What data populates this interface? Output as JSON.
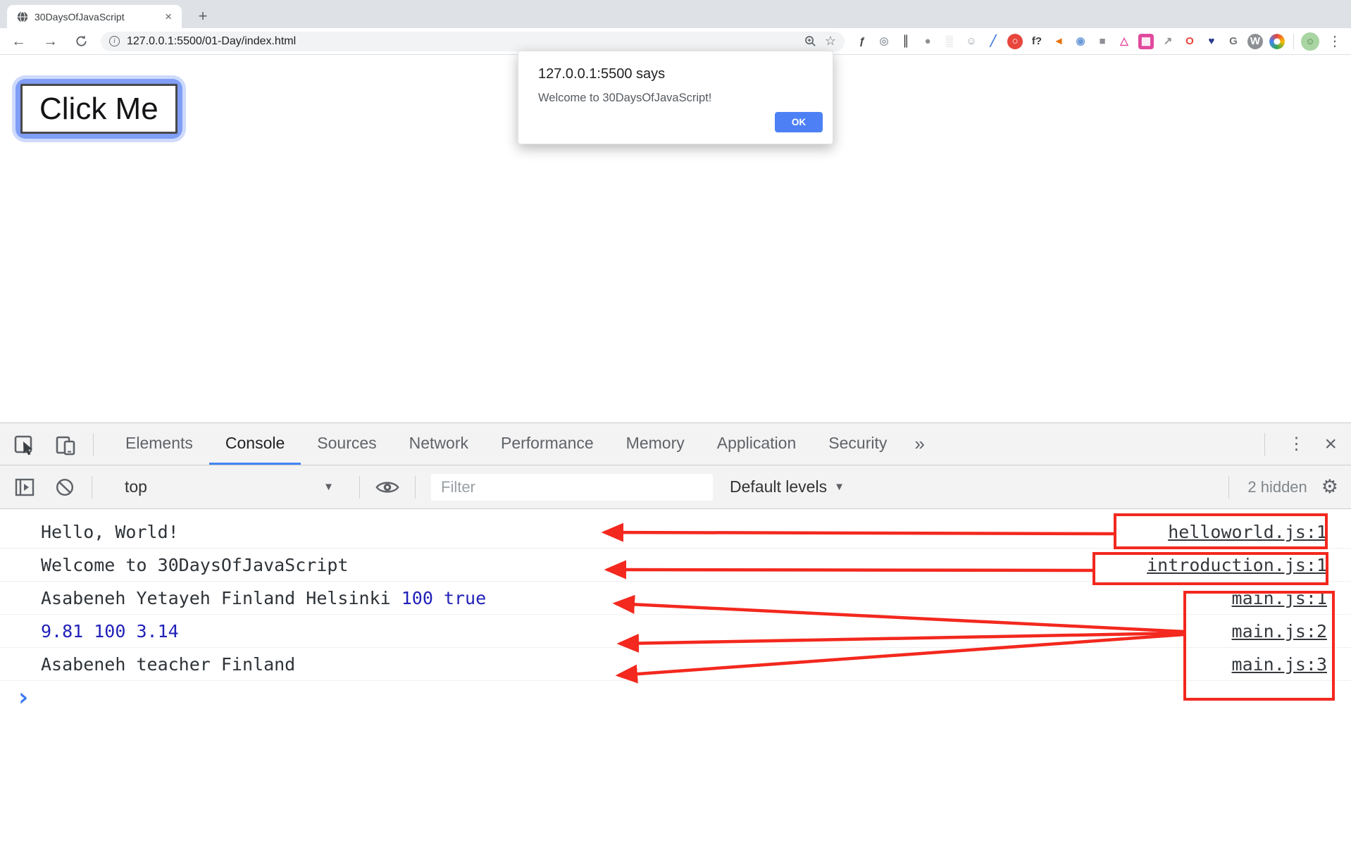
{
  "colors": {
    "accent_blue": "#4285f4",
    "alert_ok_blue": "#4d80f4",
    "number_blue": "#2121b8",
    "prompt_blue": "#3a79f2",
    "annotation_red": "#f3281e",
    "tabstrip_gray": "#dee1e6",
    "devtools_bar_gray": "#f3f3f3"
  },
  "browser": {
    "tab_title": "30DaysOfJavaScript",
    "tab_close": "×",
    "new_tab": "+",
    "back": "←",
    "forward": "→",
    "url": "127.0.0.1:5500/01-Day/index.html",
    "bookmark_star": "☆",
    "menu_kebab": "⋮",
    "extensions": [
      {
        "name": "script-f-extension-icon",
        "glyph": "ƒ",
        "fg": "#3f4043",
        "bg": "",
        "shape": ""
      },
      {
        "name": "target-extension-icon",
        "glyph": "◎",
        "fg": "#9aa0a6",
        "bg": "",
        "shape": ""
      },
      {
        "name": "pause-extension-icon",
        "glyph": "║",
        "fg": "#6f7control4",
        "bg": "",
        "shape": ""
      },
      {
        "name": "bug-extension-icon",
        "glyph": "●",
        "fg": "#8d9094",
        "bg": "",
        "shape": ""
      },
      {
        "name": "grid-extension-icon",
        "glyph": "▒",
        "fg": "#d5d7d9",
        "bg": "",
        "shape": ""
      },
      {
        "name": "emoji-extension-icon",
        "glyph": "☺",
        "fg": "#9aa0a6",
        "bg": "",
        "shape": ""
      },
      {
        "name": "dropper-extension-icon",
        "glyph": "╱",
        "fg": "#4f7fe0",
        "bg": "",
        "shape": ""
      },
      {
        "name": "stop-hand-extension-icon",
        "glyph": "○",
        "fg": "#ffffff",
        "bg": "#e8453c",
        "shape": "circle"
      },
      {
        "name": "f-question-extension-icon",
        "glyph": "f?",
        "fg": "#3b3b3b",
        "bg": "",
        "shape": ""
      },
      {
        "name": "megaphone-extension-icon",
        "glyph": "◄",
        "fg": "#e8710a",
        "bg": "",
        "shape": ""
      },
      {
        "name": "swirl-extension-icon",
        "glyph": "◉",
        "fg": "#6d9bd8",
        "bg": "",
        "shape": ""
      },
      {
        "name": "camera-extension-icon",
        "glyph": "■",
        "fg": "#8d9094",
        "bg": "",
        "shape": ""
      },
      {
        "name": "bell-extension-icon",
        "glyph": "△",
        "fg": "#e649a0",
        "bg": "",
        "shape": ""
      },
      {
        "name": "qr-extension-icon",
        "glyph": "▦",
        "fg": "#ffffff",
        "bg": "#e14a9d",
        "shape": "square"
      },
      {
        "name": "share-extension-icon",
        "glyph": "↗",
        "fg": "#8d9094",
        "bg": "",
        "shape": ""
      },
      {
        "name": "opera-extension-icon",
        "glyph": "O",
        "fg": "#e8453c",
        "bg": "",
        "shape": ""
      },
      {
        "name": "heart-search-extension-icon",
        "glyph": "♥",
        "fg": "#2b3a8f",
        "bg": "",
        "shape": ""
      },
      {
        "name": "g-arrow-extension-icon",
        "glyph": "G",
        "fg": "#707579",
        "bg": "",
        "shape": ""
      },
      {
        "name": "w-extension-icon",
        "glyph": "W",
        "fg": "#ffffff",
        "bg": "#8d9094",
        "shape": "circle"
      },
      {
        "name": "color-wheel-extension-icon",
        "glyph": "",
        "fg": "",
        "bg": "",
        "shape": "wheel"
      }
    ],
    "avatar_glyph": "☺"
  },
  "page": {
    "click_me_label": "Click Me",
    "alert": {
      "title": "127.0.0.1:5500 says",
      "message": "Welcome to 30DaysOfJavaScript!",
      "ok_label": "OK"
    }
  },
  "devtools": {
    "tabs": [
      "Elements",
      "Console",
      "Sources",
      "Network",
      "Performance",
      "Memory",
      "Application",
      "Security"
    ],
    "selected_tab": "Console",
    "more_tabs": "»",
    "kebab": "⋮",
    "close": "×",
    "toolbar": {
      "context_label": "top",
      "caret": "▼",
      "filter_placeholder": "Filter",
      "levels_label": "Default levels",
      "hidden_label": "2 hidden",
      "gear": "⚙"
    },
    "console": {
      "rows": [
        {
          "text": "Hello, World!",
          "link": "helloworld.js:1"
        },
        {
          "text": "Welcome to 30DaysOfJavaScript",
          "link": "introduction.js:1"
        },
        {
          "text": "Asabeneh Yetayeh Finland Helsinki ",
          "text2": "100 true",
          "link": "main.js:1"
        },
        {
          "text": "9.81 100 3.14",
          "link": "main.js:2"
        },
        {
          "text": "Asabeneh teacher Finland",
          "link": "main.js:3"
        }
      ],
      "prompt_glyph": "›"
    }
  }
}
